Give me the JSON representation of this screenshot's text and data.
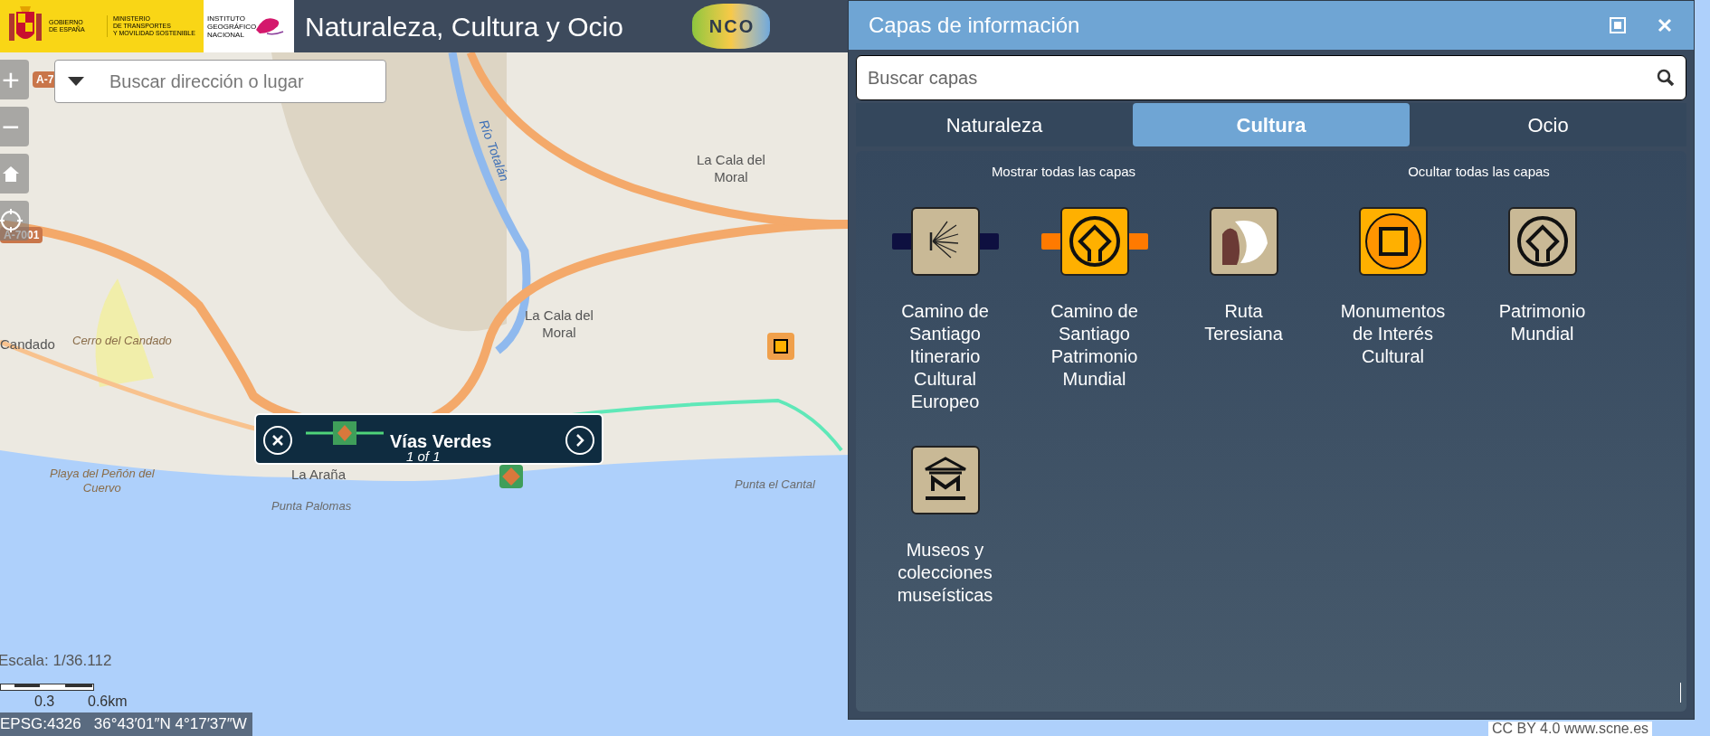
{
  "header": {
    "gov_text": "GOBIERNO\nDE ESPAÑA",
    "ministry_text": "MINISTERIO\nDE TRANSPORTES\nY MOVILIDAD SOSTENIBLE",
    "institute_text": "INSTITUTO\nGEOGRÁFICO\nNACIONAL",
    "title": "Naturaleza, Cultura y Ocio",
    "logo_letters": [
      "N",
      "C",
      "O"
    ]
  },
  "map": {
    "search": {
      "placeholder": "Buscar dirección o lugar"
    },
    "controls": [
      {
        "kind": "zoom-in",
        "label": "+"
      },
      {
        "kind": "zoom-out",
        "label": "−"
      },
      {
        "kind": "home"
      },
      {
        "kind": "locate"
      }
    ],
    "road_labels": [
      "A-7",
      "A-7001"
    ],
    "labels": [
      {
        "text": "Río Totalán",
        "kind": "water"
      },
      {
        "text": "La Cala del\nMoral",
        "kind": "town"
      },
      {
        "text": "La Cala del\nMoral",
        "kind": "town"
      },
      {
        "text": "Candado",
        "kind": "town"
      },
      {
        "text": "Cerro del Candado",
        "kind": "feature"
      },
      {
        "text": "Playa del Peñón del\nCuervo",
        "kind": "feature"
      },
      {
        "text": "La Araña",
        "kind": "town"
      },
      {
        "text": "Punta Palomas",
        "kind": "feature"
      },
      {
        "text": "Punta el Cantal",
        "kind": "feature"
      }
    ],
    "popup": {
      "title": "Vías Verdes",
      "pager": "1 of 1"
    },
    "scale_text": "Escala: 1/36.112",
    "scale_ticks": [
      "0.3",
      "0.6km"
    ],
    "coordinates": {
      "crs": "EPSG:4326",
      "position": "36°43′01″N 4°17′37″W"
    },
    "attribution": "CC BY 4.0 www.scne.es"
  },
  "panel": {
    "title": "Capas de información",
    "search": {
      "placeholder": "Buscar capas"
    },
    "tabs": [
      {
        "label": "Naturaleza",
        "selected": false
      },
      {
        "label": "Cultura",
        "selected": true
      },
      {
        "label": "Ocio",
        "selected": false
      }
    ],
    "actions": [
      "Mostrar todas las capas",
      "Ocultar todas las capas"
    ],
    "layers": [
      {
        "label": "Camino de Santiago Itinerario Cultural Europeo",
        "kind": "shell"
      },
      {
        "label": "Camino de Santiago Patrimonio Mundial",
        "kind": "heritage-route"
      },
      {
        "label": "Ruta Teresiana",
        "kind": "photo"
      },
      {
        "label": "Monumentos de Interés Cultural",
        "kind": "monument"
      },
      {
        "label": "Patrimonio Mundial",
        "kind": "heritage"
      },
      {
        "label": "Museos y colecciones museísticas",
        "kind": "museum"
      }
    ]
  }
}
